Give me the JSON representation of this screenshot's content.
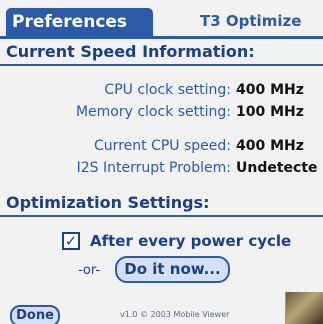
{
  "header": {
    "title": "Preferences",
    "app_name": "T3 Optimize"
  },
  "speed_info": {
    "heading": "Current Speed Information:",
    "rows": [
      {
        "label": "CPU clock setting:",
        "value": "400 MHz"
      },
      {
        "label": "Memory clock setting:",
        "value": "100 MHz"
      },
      {
        "label": "Current CPU speed:",
        "value": "400 MHz"
      },
      {
        "label": "I2S Interrupt Problem:",
        "value": "Undetecte"
      }
    ]
  },
  "optimization": {
    "heading": "Optimization Settings:",
    "checkbox_label": "After every power cycle",
    "checkbox_checked": true,
    "checkbox_glyph": "✓",
    "or_text": "-or-",
    "do_it_button": "Do it now..."
  },
  "footer": {
    "done_button": "Done",
    "version": "v1.0 © 2003 Mobile Viewer"
  }
}
